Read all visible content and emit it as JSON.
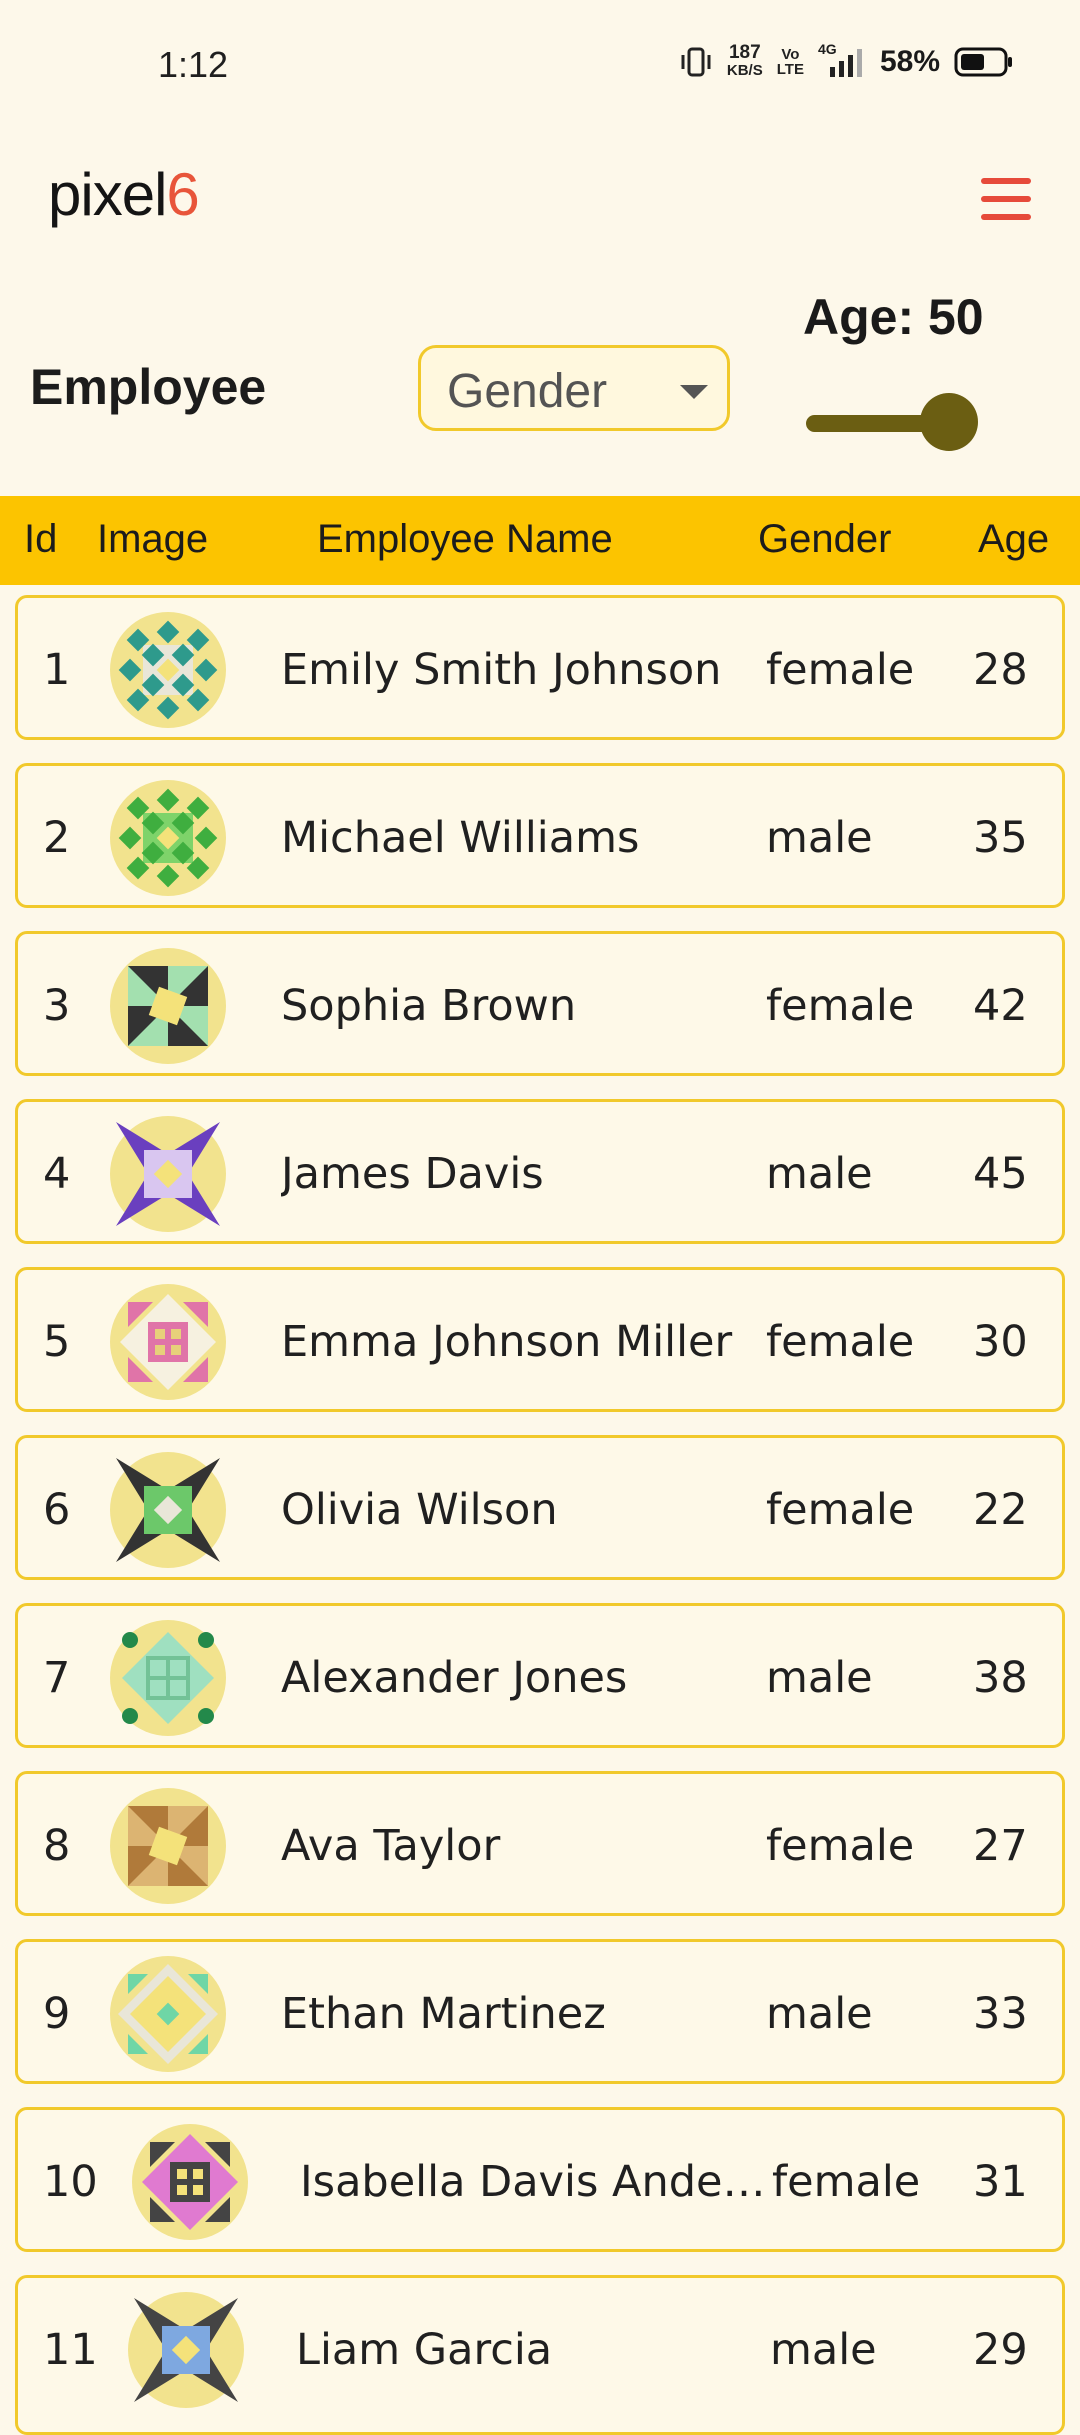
{
  "status_bar": {
    "time": "1:12",
    "net_speed_value": "187",
    "net_speed_unit": "KB/S",
    "volte_top": "Vo",
    "volte_bottom": "LTE",
    "network": "4G",
    "battery_percent": "58%",
    "battery_level": 0.58
  },
  "app_bar": {
    "logo_text": "pixel",
    "logo_number": "6",
    "menu_icon": "hamburger-menu-icon",
    "accent_color": "#e64a3a"
  },
  "filters": {
    "title": "Employee",
    "gender_select": {
      "selected": "Gender",
      "icon": "dropdown-caret-icon"
    },
    "age": {
      "label": "Age: 50",
      "value": 50,
      "min": 0,
      "max": 60
    }
  },
  "table": {
    "header_color": "#fcc400",
    "columns": [
      "Id",
      "Image",
      "Employee Name",
      "Gender",
      "Age"
    ],
    "rows": [
      {
        "id": "1",
        "name": "Emily Smith Johnson",
        "gender": "female",
        "age": "28",
        "avatar": "quilt-teal-diamonds"
      },
      {
        "id": "2",
        "name": "Michael  Williams",
        "gender": "male",
        "age": "35",
        "avatar": "quilt-green-diamonds"
      },
      {
        "id": "3",
        "name": "Sophia  Brown",
        "gender": "female",
        "age": "42",
        "avatar": "quilt-dark-mint-pinwheel"
      },
      {
        "id": "4",
        "name": "James  Davis",
        "gender": "male",
        "age": "45",
        "avatar": "quilt-purple-lavender"
      },
      {
        "id": "5",
        "name": "Emma Johnson Miller",
        "gender": "female",
        "age": "30",
        "avatar": "quilt-pink-square"
      },
      {
        "id": "6",
        "name": "Olivia  Wilson",
        "gender": "female",
        "age": "22",
        "avatar": "quilt-green-star"
      },
      {
        "id": "7",
        "name": "Alexander  Jones",
        "gender": "male",
        "age": "38",
        "avatar": "quilt-mint-window"
      },
      {
        "id": "8",
        "name": "Ava  Taylor",
        "gender": "female",
        "age": "27",
        "avatar": "quilt-brown-pinwheel"
      },
      {
        "id": "9",
        "name": "Ethan  Martinez",
        "gender": "male",
        "age": "33",
        "avatar": "quilt-mint-diamond"
      },
      {
        "id": "10",
        "name": "Isabella Davis Anderson",
        "gender": "female",
        "age": "31",
        "avatar": "quilt-pink-dark-corners"
      },
      {
        "id": "11",
        "name": "Liam  Garcia",
        "gender": "male",
        "age": "29",
        "avatar": "quilt-blue-dark-corners"
      }
    ]
  }
}
